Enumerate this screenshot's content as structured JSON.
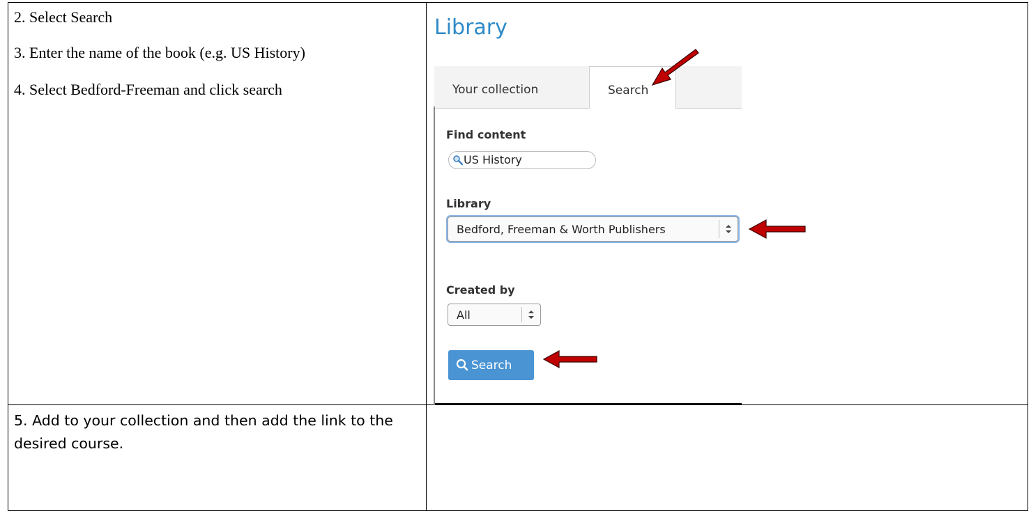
{
  "instructions": {
    "step2": "2.  Select Search",
    "step3": "3.  Enter the name of the book (e.g. US History)",
    "step4": "4.  Select Bedford-Freeman and click search",
    "step5": "5. Add to your collection and then add the link to the desired course."
  },
  "screenshot": {
    "title": "Library",
    "tabs": [
      {
        "label": "Your collection"
      },
      {
        "label": "Search"
      }
    ],
    "find_content_label": "Find content",
    "search_value": "US History",
    "library_label": "Library",
    "library_value": "Bedford, Freeman & Worth Publishers",
    "created_by_label": "Created by",
    "created_by_value": "All",
    "search_button": "Search"
  },
  "colors": {
    "title": "#2e8ac7",
    "button": "#4a94d4",
    "arrow": "#c00000"
  }
}
